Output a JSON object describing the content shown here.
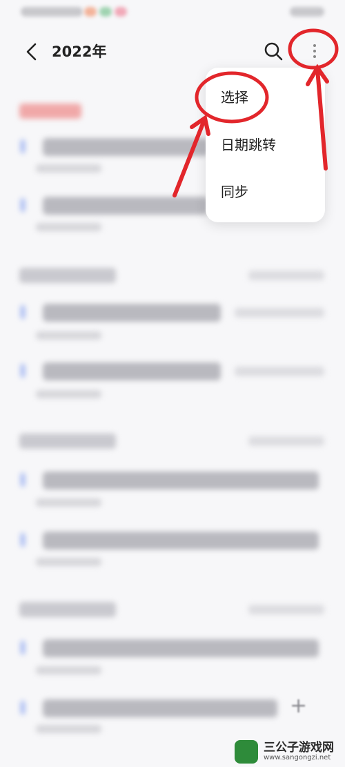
{
  "header": {
    "title": "2022年"
  },
  "menu": {
    "items": [
      {
        "label": "选择"
      },
      {
        "label": "日期跳转"
      },
      {
        "label": "同步"
      }
    ]
  },
  "watermark": {
    "brand": "三公子游戏网",
    "url": "www.sangongzi.net"
  },
  "icons": {
    "back": "chevron-left-icon",
    "search": "search-icon",
    "more": "more-vertical-icon",
    "add": "plus-icon"
  },
  "colors": {
    "annotation": "#e2262b",
    "accent_dot": "#9fb4f2",
    "background": "#f7f7f9"
  }
}
